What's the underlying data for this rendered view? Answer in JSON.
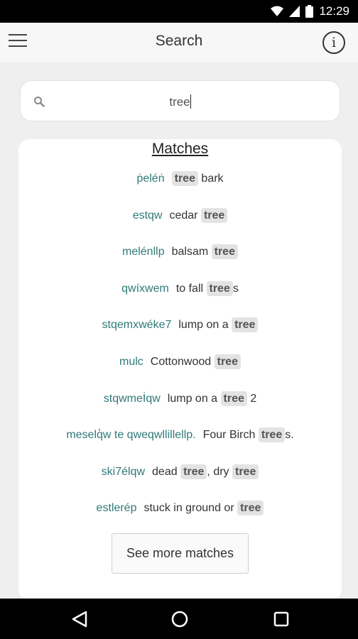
{
  "status_bar": {
    "time": "12:29",
    "icons": [
      "wifi-icon",
      "cell-signal-icon",
      "battery-icon"
    ]
  },
  "app_bar": {
    "title": "Search",
    "menu_icon": "hamburger-menu-icon",
    "info_icon": "info-icon",
    "info_glyph": "i"
  },
  "search": {
    "icon": "search-icon",
    "value": "tree"
  },
  "matches": {
    "title": "Matches",
    "items": [
      {
        "word": "ṗeléṅ",
        "parts": [
          {
            "t": "tree",
            "hl": true
          },
          {
            "t": " bark",
            "hl": false
          }
        ]
      },
      {
        "word": "estqw",
        "parts": [
          {
            "t": "cedar ",
            "hl": false
          },
          {
            "t": "tree",
            "hl": true
          }
        ]
      },
      {
        "word": "melénllp",
        "parts": [
          {
            "t": "balsam ",
            "hl": false
          },
          {
            "t": "tree",
            "hl": true
          }
        ]
      },
      {
        "word": "qwíxwem",
        "parts": [
          {
            "t": "to fall ",
            "hl": false
          },
          {
            "t": "tree",
            "hl": true
          },
          {
            "t": "s",
            "hl": false
          }
        ]
      },
      {
        "word": "stqemxwéke7",
        "parts": [
          {
            "t": "lump on a ",
            "hl": false
          },
          {
            "t": "tree",
            "hl": true
          }
        ]
      },
      {
        "word": "mulc",
        "parts": [
          {
            "t": "Cottonwood ",
            "hl": false
          },
          {
            "t": "tree",
            "hl": true
          }
        ]
      },
      {
        "word": "stqwmeİqw",
        "parts": [
          {
            "t": "lump on a ",
            "hl": false
          },
          {
            "t": "tree",
            "hl": true
          },
          {
            "t": " 2",
            "hl": false
          }
        ]
      },
      {
        "word": "meselq̓w te qweqwllillellp.",
        "parts": [
          {
            "t": "Four Birch ",
            "hl": false
          },
          {
            "t": "tree",
            "hl": true
          },
          {
            "t": "s.",
            "hl": false
          }
        ]
      },
      {
        "word": "ski7élqw",
        "parts": [
          {
            "t": "dead ",
            "hl": false
          },
          {
            "t": "tree",
            "hl": true
          },
          {
            "t": ", dry ",
            "hl": false
          },
          {
            "t": "tree",
            "hl": true
          }
        ]
      },
      {
        "word": "estlerép",
        "parts": [
          {
            "t": "stuck in ground or ",
            "hl": false
          },
          {
            "t": "tree",
            "hl": true
          }
        ]
      }
    ],
    "more_button": "See more matches"
  },
  "nav_bar": {
    "icons": [
      "back-icon",
      "home-icon",
      "recents-icon"
    ]
  }
}
